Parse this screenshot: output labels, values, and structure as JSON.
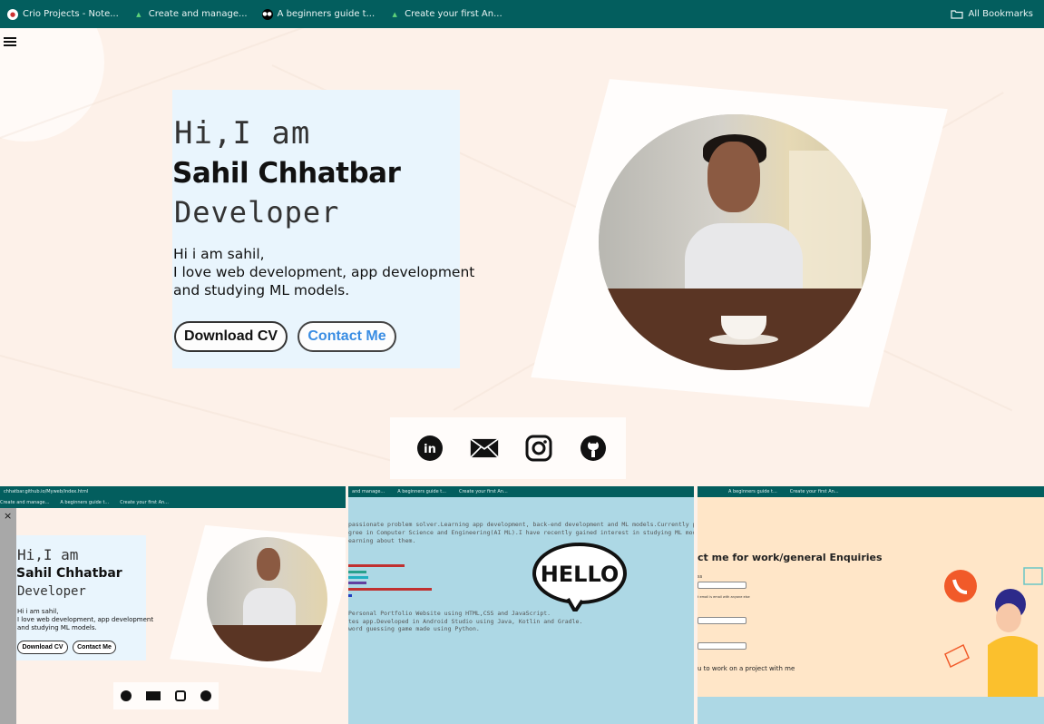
{
  "bookmarks": {
    "items": [
      {
        "label": "Crio Projects - Note...",
        "icon": "crio-icon"
      },
      {
        "label": "Create and manage...",
        "icon": "android-icon"
      },
      {
        "label": "A beginners guide t...",
        "icon": "medium-icon"
      },
      {
        "label": "Create your first An...",
        "icon": "android-icon"
      }
    ],
    "all_label": "All Bookmarks"
  },
  "hero": {
    "greeting": "Hi,I am",
    "name": "Sahil Chhatbar",
    "role": "Developer",
    "bio_line1": "Hi i am sahil,",
    "bio_line2": "I love web development, app development",
    "bio_line3": "and studying ML models.",
    "download_cv_label": "Download CV",
    "contact_me_label": "Contact Me",
    "photo_alt": "profile-photo"
  },
  "social": [
    "linkedin-icon",
    "mail-icon",
    "instagram-icon",
    "github-icon"
  ],
  "thumbnails": {
    "t1": {
      "url": "chhatbar.github.io/Myweb/index.html",
      "bookmarks": [
        "Create and manage...",
        "A beginners guide t...",
        "Create your first An..."
      ],
      "close": "×",
      "greeting": "Hi,I am",
      "name": "Sahil Chhatbar",
      "role": "Developer",
      "bio_line1": "Hi i am sahil,",
      "bio_line2": "I love web development, app development",
      "bio_line3": "and studying ML models.",
      "download_cv_label": "Download CV",
      "contact_me_label": "Contact Me"
    },
    "t2": {
      "bookmarks": [
        "and manage...",
        "A beginners guide t...",
        "Create your first An..."
      ],
      "about_line1": "passionate problem solver.Learning app development, back-end development and ML models.Currently pu",
      "about_line2": "gree in Computer Science and Engineering(AI ML).I have recently gained interest in studying ML model",
      "about_line3": "earning about them.",
      "project1": "Personal Portfolio Website using HTML,CSS and JavaScript.",
      "project2": "tes app.Developed in Android Studio using Java, Kotlin and Gradle.",
      "project3": "word guessing game made using Python.",
      "hello": "HELLO"
    },
    "t3": {
      "bookmarks": [
        "A beginners guide t...",
        "Create your first An..."
      ],
      "title": "ct me for work/general Enquiries",
      "email_label": "ss",
      "email_hint": "t email is email with anyone else",
      "message": "u to work on a project with me"
    }
  }
}
